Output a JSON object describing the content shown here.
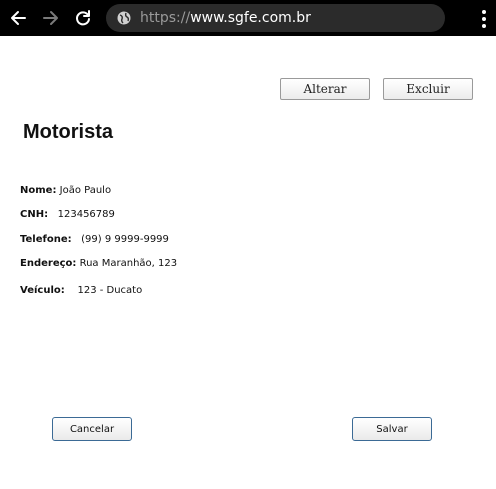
{
  "browser": {
    "url_scheme": "https://",
    "url_host": "www.sgfe.com.br"
  },
  "actions": {
    "alterar": "Alterar",
    "excluir": "Excluir"
  },
  "page": {
    "title": "Motorista"
  },
  "fields": [
    {
      "label": "Nome:",
      "value": "João Paulo"
    },
    {
      "label": "CNH:",
      "value": "123456789"
    },
    {
      "label": "Telefone:",
      "value": "(99) 9 9999-9999"
    },
    {
      "label": "Endereço:",
      "value": "Rua Maranhão, 123"
    },
    {
      "label": "Veículo:",
      "value": "123 - Ducato"
    }
  ],
  "footer": {
    "cancelar": "Cancelar",
    "salvar": "Salvar"
  }
}
